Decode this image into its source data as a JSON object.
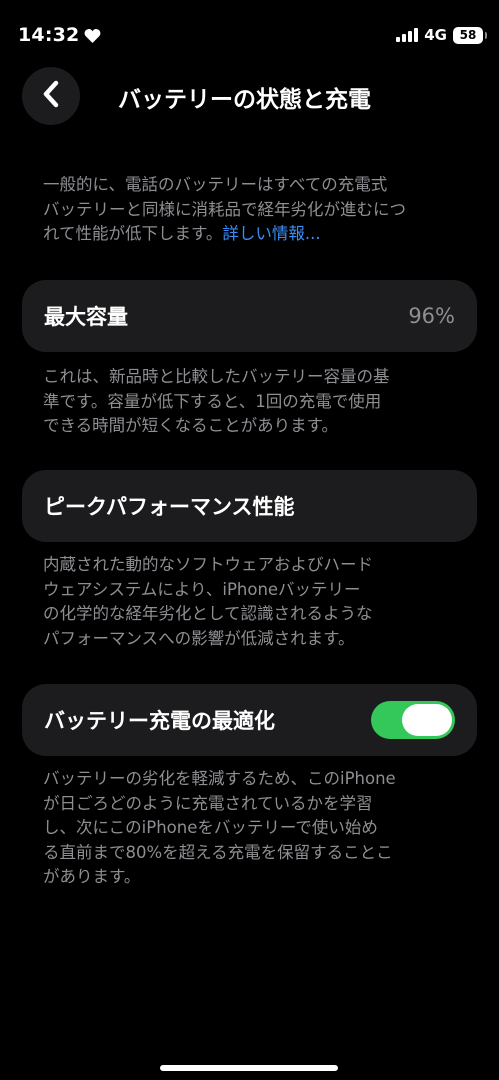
{
  "status_bar": {
    "time": "14:32",
    "network": "4G",
    "battery": "58"
  },
  "header": {
    "title": "バッテリーの状態と充電"
  },
  "intro": {
    "lines": [
      "一般的に、電話のバッテリーはすべての充電式",
      "バッテリーと同様に消耗品で経年劣化が進むにつ",
      "れて性能が低下します。"
    ],
    "link": "詳しい情報..."
  },
  "max_capacity": {
    "label": "最大容量",
    "value": "96%",
    "description": [
      "これは、新品時と比較したバッテリー容量の基",
      "準です。容量が低下すると、1回の充電で使用",
      "できる時間が短くなることがあります。"
    ]
  },
  "peak_performance": {
    "label": "ピークパフォーマンス性能",
    "description": [
      "内蔵された動的なソフトウェアおよびハード",
      "ウェアシステムにより、iPhoneバッテリー",
      "の化学的な経年劣化として認識されるような",
      "パフォーマンスへの影響が低減されます。"
    ]
  },
  "optimized_charging": {
    "label": "バッテリー充電の最適化",
    "enabled": true,
    "toggle_color": "#34c759",
    "description": [
      "バッテリーの劣化を軽減するため、このiPhone",
      "が日ごろどのように充電されているかを学習",
      "し、次にこのiPhoneをバッテリーで使い始め",
      "る直前まで80%を超える充電を保留することこ",
      "があります。"
    ]
  },
  "colors": {
    "background": "#000000",
    "card": "#1c1c1e",
    "secondary_text": "#8e8e93",
    "link": "#3a8df7"
  },
  "icons": {
    "back": "chevron-left-icon",
    "heart": "heart-icon",
    "signal": "signal-icon",
    "battery": "battery-icon"
  }
}
